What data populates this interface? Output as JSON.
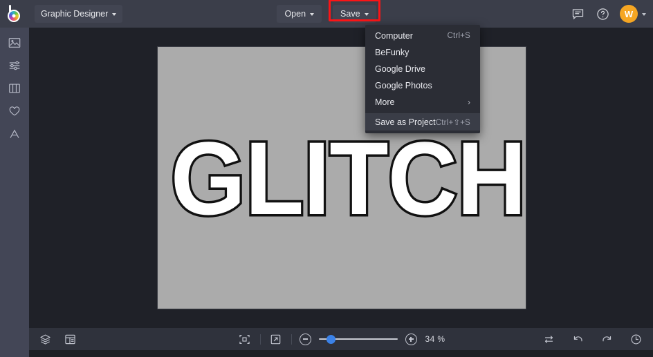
{
  "header": {
    "logo_icon": "befunky-logo-icon",
    "app_mode": "Graphic Designer",
    "open_label": "Open",
    "save_label": "Save",
    "feedback_icon": "chat-bubble-icon",
    "help_icon": "help-circle-icon",
    "avatar_initial": "W",
    "highlight_color": "#fb1416"
  },
  "save_menu": {
    "items": [
      {
        "label": "Computer",
        "shortcut": "Ctrl+S",
        "arrow": ""
      },
      {
        "label": "BeFunky",
        "shortcut": "",
        "arrow": ""
      },
      {
        "label": "Google Drive",
        "shortcut": "",
        "arrow": ""
      },
      {
        "label": "Google Photos",
        "shortcut": "",
        "arrow": ""
      },
      {
        "label": "More",
        "shortcut": "",
        "arrow": "›"
      },
      {
        "label": "Save as Project",
        "shortcut": "Ctrl+⇧+S",
        "arrow": ""
      }
    ]
  },
  "sidebar": {
    "items": [
      {
        "name": "image-manager",
        "icon": "image-icon"
      },
      {
        "name": "edit",
        "icon": "sliders-icon"
      },
      {
        "name": "templates",
        "icon": "columns-icon"
      },
      {
        "name": "graphics",
        "icon": "heart-icon"
      },
      {
        "name": "text",
        "icon": "text-a-icon"
      }
    ]
  },
  "canvas": {
    "text": "GLITCH",
    "text_fill": "#ffffff",
    "text_stroke": "#111111",
    "background": "#ababab"
  },
  "bottombar": {
    "layers_icon": "layers-icon",
    "panel_icon": "layout-panel-icon",
    "fit_icon": "fit-to-screen-icon",
    "expand_icon": "expand-arrow-icon",
    "zoom_out_icon": "minus-circle-icon",
    "zoom_in_icon": "plus-circle-icon",
    "zoom_value": "34 %",
    "zoom_percent": 34,
    "slider_handle_percent": 11,
    "compare_icon": "swap-compare-icon",
    "undo_icon": "undo-arrow-icon",
    "redo_icon": "redo-arrow-icon",
    "history_icon": "history-clock-icon",
    "accent_color": "#3b82e8"
  }
}
